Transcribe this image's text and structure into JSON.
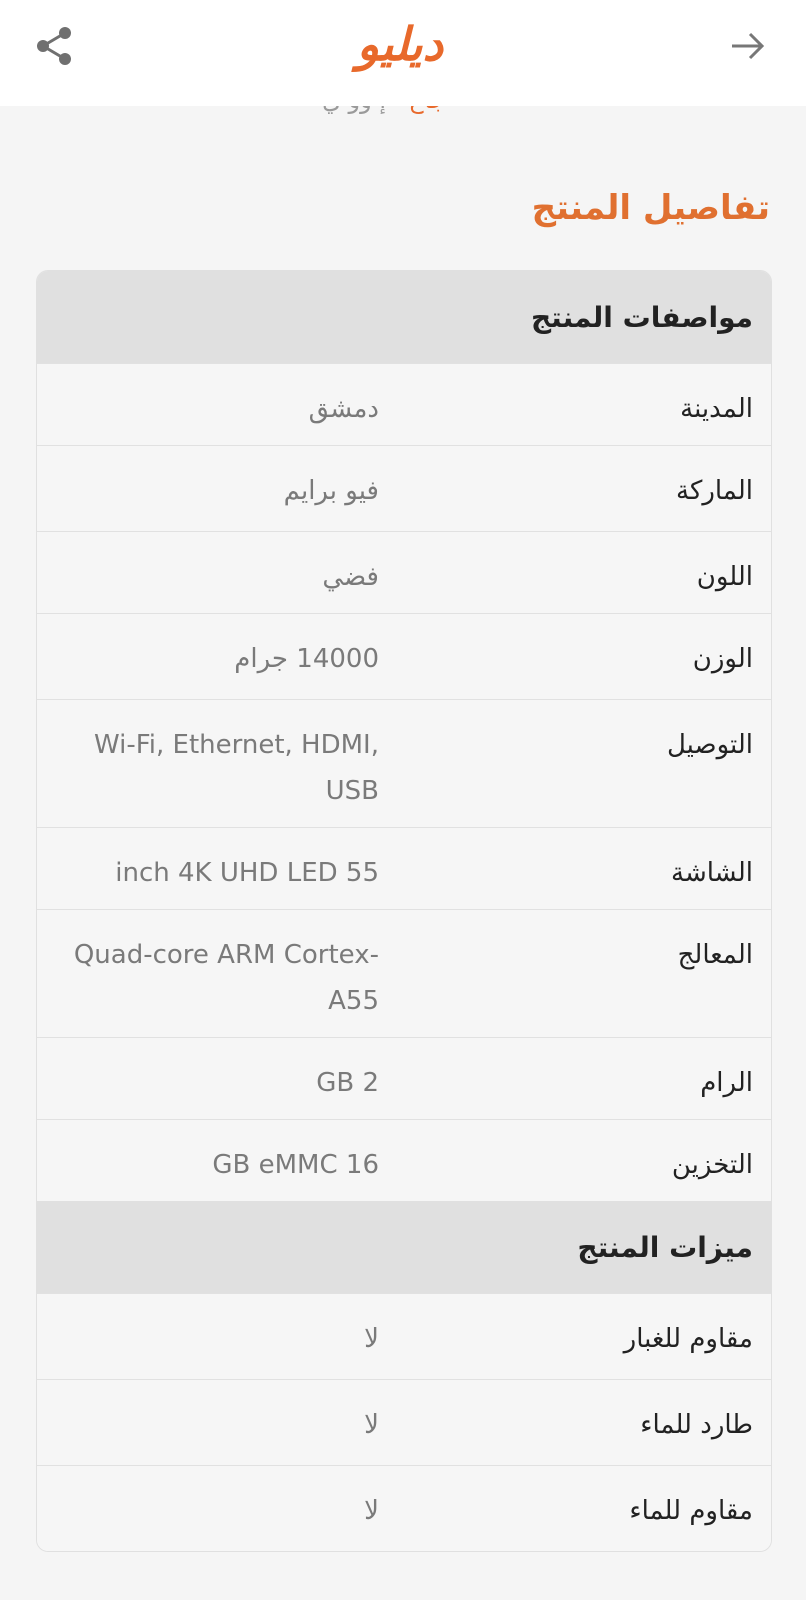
{
  "app": {
    "logo_text": "ديليو"
  },
  "colors": {
    "brand": "#e8692b",
    "title": "#e07030"
  },
  "icons": {
    "share": "share-icon",
    "back": "arrow-right-icon"
  },
  "peek_text": {
    "orange": "جاع",
    "grey": "إ وو ي"
  },
  "section_title": "تفاصيل المنتج",
  "specs": {
    "title": "مواصفات المنتج",
    "rows": [
      {
        "label": "المدينة",
        "value": "دمشق"
      },
      {
        "label": "الماركة",
        "value": "فيو برايم"
      },
      {
        "label": "اللون",
        "value": "فضي"
      },
      {
        "label": "الوزن",
        "value": "14000 جرام"
      },
      {
        "label": "التوصيل",
        "value": "Wi-Fi, Ethernet, HDMI, USB"
      },
      {
        "label": "الشاشة",
        "value": "inch 4K UHD LED 55"
      },
      {
        "label": "المعالج",
        "value": "Quad-core ARM Cortex-A55"
      },
      {
        "label": "الرام",
        "value": "GB 2"
      },
      {
        "label": "التخزين",
        "value": "GB eMMC 16"
      }
    ]
  },
  "features": {
    "title": "ميزات المنتج",
    "rows": [
      {
        "label": "مقاوم للغبار",
        "value": "لا"
      },
      {
        "label": "طارد للماء",
        "value": "لا"
      },
      {
        "label": "مقاوم للماء",
        "value": "لا"
      }
    ]
  }
}
